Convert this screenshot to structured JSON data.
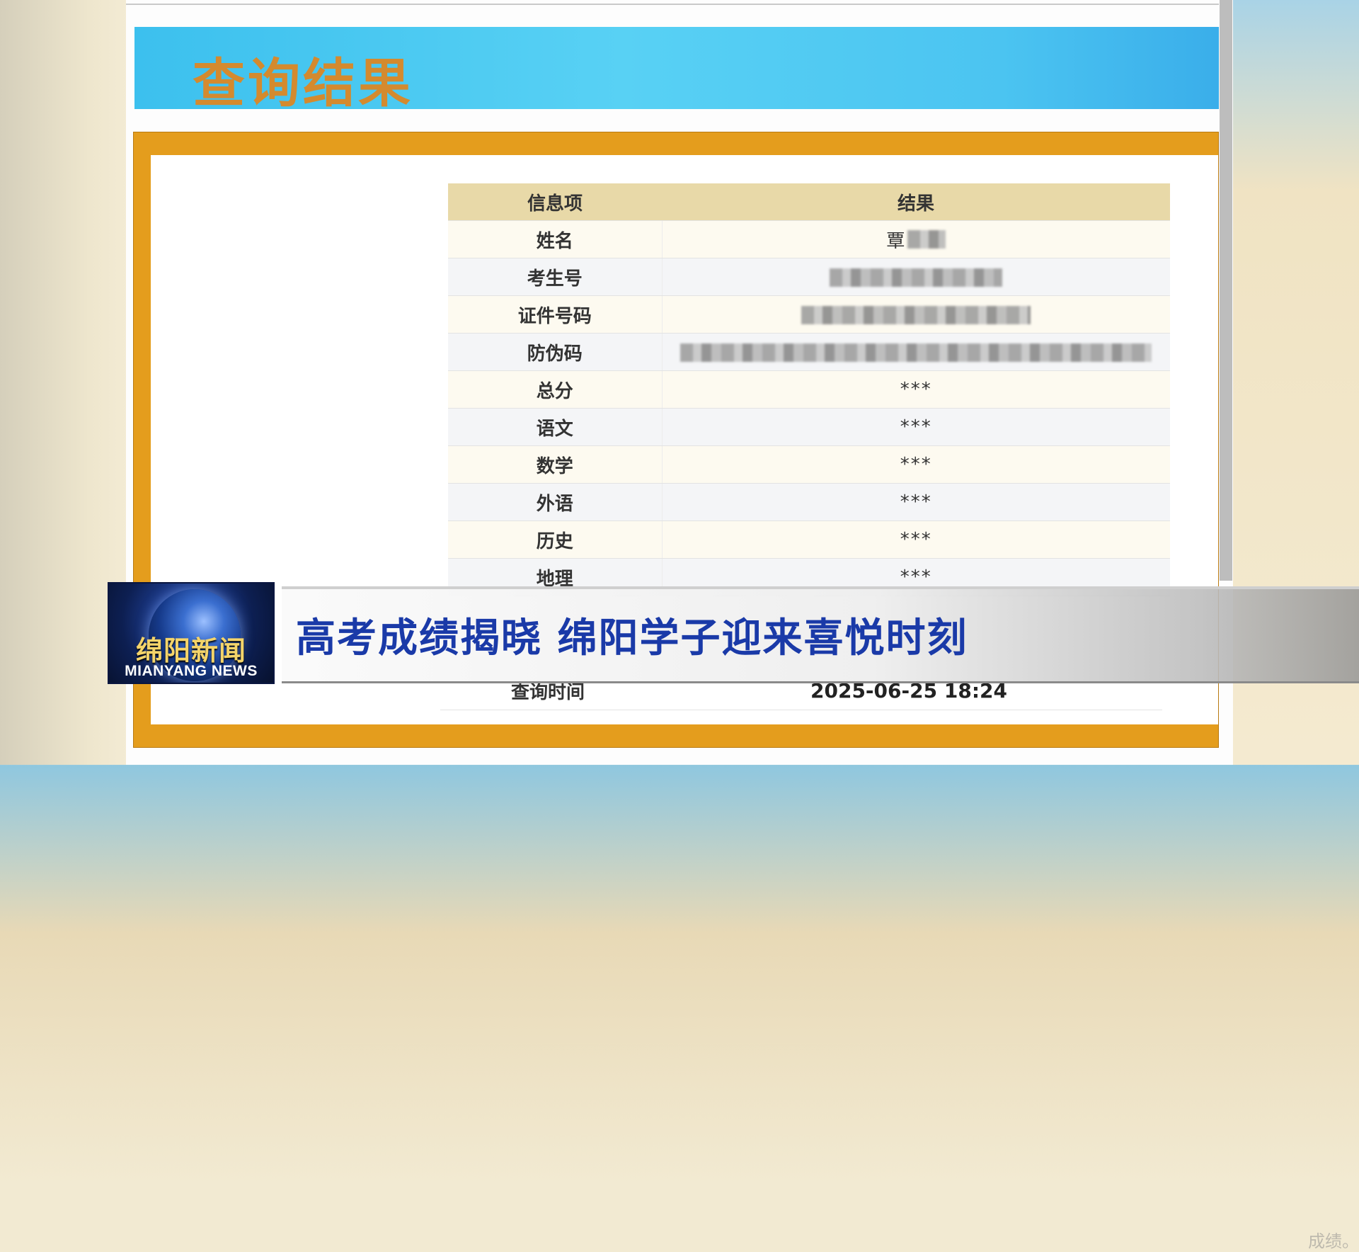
{
  "banner": {
    "title": "查询结果"
  },
  "table": {
    "headers": [
      "信息项",
      "结果"
    ],
    "rows": [
      {
        "label": "姓名",
        "value": "覃",
        "masked": true
      },
      {
        "label": "考生号",
        "value": "",
        "masked": true
      },
      {
        "label": "证件号码",
        "value": "",
        "masked": true
      },
      {
        "label": "防伪码",
        "value": "",
        "masked": true
      },
      {
        "label": "总分",
        "value": "***"
      },
      {
        "label": "语文",
        "value": "***"
      },
      {
        "label": "数学",
        "value": "***"
      },
      {
        "label": "外语",
        "value": "***"
      },
      {
        "label": "历史",
        "value": "***"
      },
      {
        "label": "地理",
        "value": "***"
      }
    ]
  },
  "query_time": {
    "label": "查询时间",
    "value": "2025-06-25 18:24"
  },
  "faint_note": "成绩。",
  "news": {
    "headline": "高考成绩揭晓 绵阳学子迎来喜悦时刻",
    "logo_cn": "绵阳新闻",
    "logo_en": "MIANYANG NEWS"
  },
  "colors": {
    "banner_blue": "#4bc4f1",
    "banner_title": "#d48a2e",
    "frame_orange": "#e49d1d",
    "header_bg": "#e8d9a8",
    "headline_blue": "#1a3aa8"
  }
}
